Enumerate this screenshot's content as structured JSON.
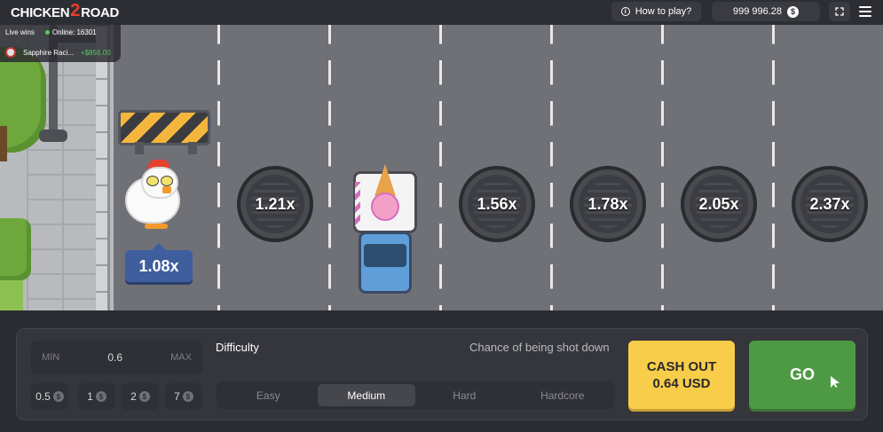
{
  "header": {
    "logo_left": "CHICKEN",
    "logo_mid": "2",
    "logo_right": "ROAD",
    "how_to_play": "How to play?",
    "balance": "999 996.28",
    "currency_symbol": "$"
  },
  "live": {
    "label": "Live wins",
    "online": "Online: 16301",
    "player": "Sapphire Raci...",
    "amount": "+$856.00"
  },
  "game": {
    "current_multiplier": "1.08x",
    "multipliers": [
      "1.21x",
      "1.56x",
      "1.78x",
      "2.05x",
      "2.37x"
    ]
  },
  "controls": {
    "min_label": "MIN",
    "bet_value": "0.6",
    "max_label": "MAX",
    "quick_bets": [
      "0.5",
      "1",
      "2",
      "7"
    ],
    "difficulty_label": "Difficulty",
    "chance_label": "Chance of being shot down",
    "difficulties": [
      "Easy",
      "Medium",
      "Hard",
      "Hardcore"
    ],
    "selected_difficulty": "Medium",
    "cashout_line1": "CASH OUT",
    "cashout_line2": "0.64 USD",
    "go_label": "GO"
  }
}
